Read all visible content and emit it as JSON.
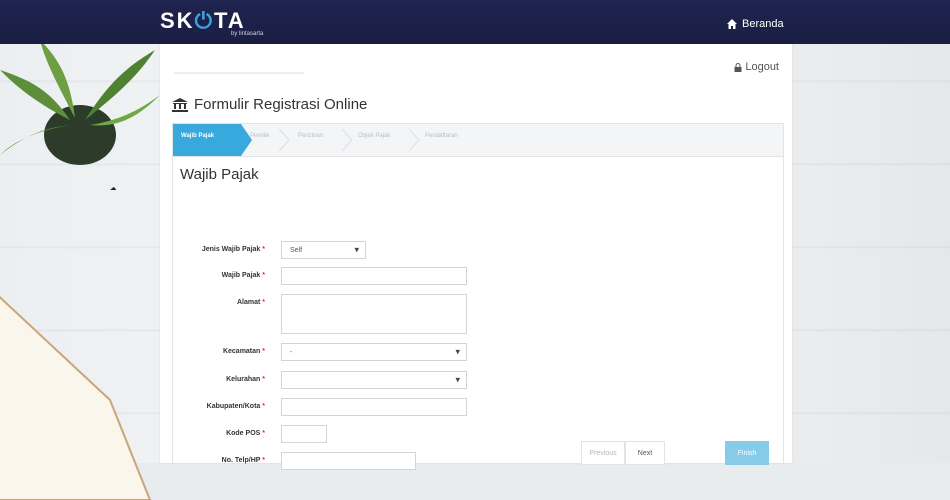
{
  "brand": {
    "name_pre": "SK",
    "name_post": "TA",
    "tagline": "by lintasarta"
  },
  "nav": {
    "home_label": "Beranda"
  },
  "header": {
    "logout_label": "Logout"
  },
  "page": {
    "title": "Formulir Registrasi Online"
  },
  "wizard": {
    "steps": [
      {
        "label": "Wajib Pajak",
        "active": true
      },
      {
        "label": "Pemilik",
        "active": false
      },
      {
        "label": "Perizinan",
        "active": false
      },
      {
        "label": "Objek Pajak",
        "active": false
      },
      {
        "label": "Pendaftaran",
        "active": false
      }
    ],
    "section_title": "Wajib Pajak"
  },
  "form": {
    "jenis_wajib_pajak": {
      "label": "Jenis Wajib Pajak",
      "value": "Self"
    },
    "wajib_pajak": {
      "label": "Wajib Pajak",
      "value": ""
    },
    "alamat": {
      "label": "Alamat",
      "value": ""
    },
    "kecamatan": {
      "label": "Kecamatan",
      "value": "-"
    },
    "kelurahan": {
      "label": "Kelurahan",
      "value": ""
    },
    "kabupaten_kota": {
      "label": "Kabupaten/Kota",
      "value": ""
    },
    "kode_pos": {
      "label": "Kode POS",
      "value": ""
    },
    "no_telp": {
      "label": "No. Telp/HP",
      "value": ""
    },
    "required_marker": "*"
  },
  "actions": {
    "previous_label": "Previous",
    "next_label": "Next",
    "finish_label": "Finish"
  },
  "colors": {
    "navbar": "#1f2450",
    "accent": "#38a9dc",
    "finish": "#86cbe9",
    "required": "#e03131"
  },
  "icons": {
    "home": "home-icon",
    "lock": "lock-icon",
    "institution": "institution-icon",
    "power": "power-icon"
  }
}
